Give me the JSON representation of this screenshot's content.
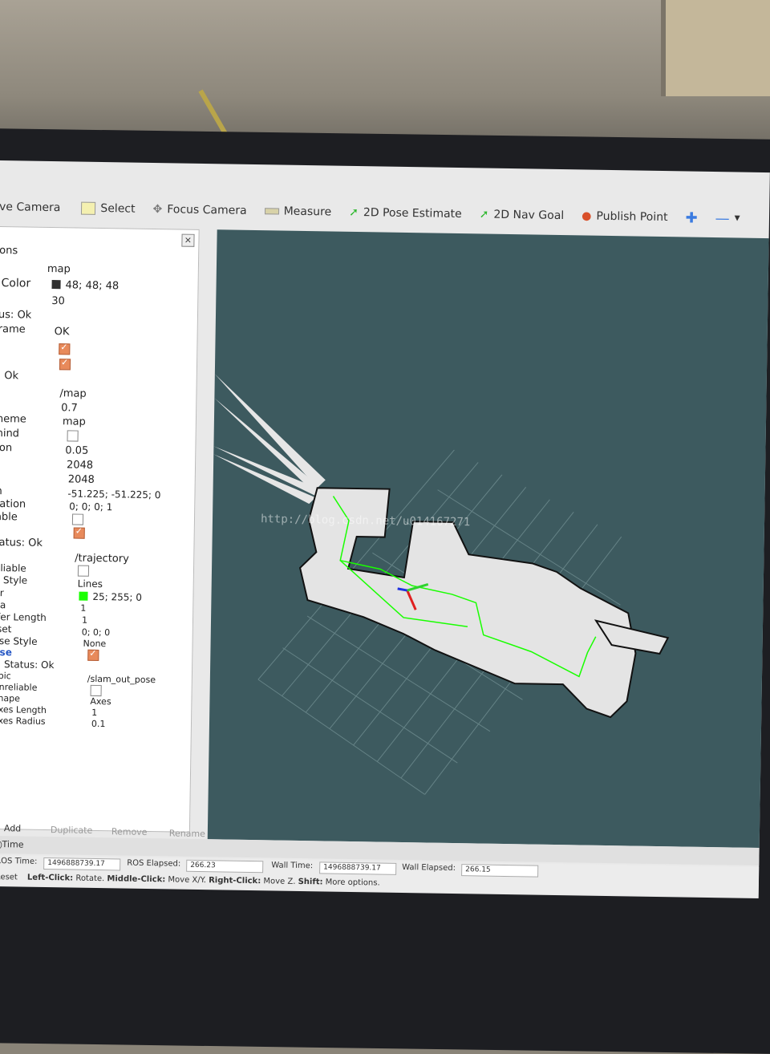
{
  "toolbar": {
    "move_camera": "ve Camera",
    "select": "Select",
    "focus_camera": "Focus Camera",
    "measure": "Measure",
    "pose_estimate": "2D Pose Estimate",
    "nav_goal": "2D Nav Goal",
    "publish_point": "Publish Point"
  },
  "panel": {
    "header": "ons",
    "close": "×",
    "rows": [
      {
        "label": "",
        "value": "map"
      },
      {
        "label": "Color",
        "value": "48; 48; 48"
      },
      {
        "label": "",
        "value": "30"
      },
      {
        "label": "us: Ok",
        "value": ""
      },
      {
        "label": "rame",
        "value": "OK"
      },
      {
        "label": ": Ok",
        "value": ""
      },
      {
        "label": "",
        "value": "/map"
      },
      {
        "label": "",
        "value": "0.7"
      },
      {
        "label": "neme",
        "value": "map"
      },
      {
        "label": "hind",
        "value": ""
      },
      {
        "label": "ion",
        "value": "0.05"
      },
      {
        "label": "",
        "value": "2048"
      },
      {
        "label": "",
        "value": "2048"
      },
      {
        "label": "n",
        "value": "-51.225; -51.225; 0"
      },
      {
        "label": "tation",
        "value": "0; 0; 0; 1"
      },
      {
        "label": "able",
        "value": ""
      },
      {
        "label": "tatus: Ok",
        "value": ""
      },
      {
        "label": "",
        "value": "/trajectory"
      },
      {
        "label": "eliable",
        "value": ""
      },
      {
        "label": "e Style",
        "value": "Lines"
      },
      {
        "label": "or",
        "value": "25; 255; 0"
      },
      {
        "label": "ha",
        "value": "1"
      },
      {
        "label": "ffer Length",
        "value": "1"
      },
      {
        "label": "fset",
        "value": "0; 0; 0"
      },
      {
        "label": "ose Style",
        "value": "None"
      },
      {
        "label": "ose",
        "value": ""
      },
      {
        "label": "Status: Ok",
        "value": ""
      },
      {
        "label": "opic",
        "value": "/slam_out_pose"
      },
      {
        "label": "Unreliable",
        "value": ""
      },
      {
        "label": "Shape",
        "value": "Axes"
      },
      {
        "label": "Axes Length",
        "value": "1"
      },
      {
        "label": "Axes Radius",
        "value": "0.1"
      }
    ],
    "buttons": {
      "add": "Add",
      "duplicate": "Duplicate",
      "remove": "Remove",
      "rename": "Rename"
    }
  },
  "time": {
    "title": "Time",
    "ros_time_label": "ROS Time:",
    "ros_time": "1496888739.17",
    "ros_elapsed_label": "ROS Elapsed:",
    "ros_elapsed": "266.23",
    "wall_time_label": "Wall Time:",
    "wall_time": "1496888739.17",
    "wall_elapsed_label": "Wall Elapsed:",
    "wall_elapsed": "266.15"
  },
  "status": {
    "reset": "Reset",
    "hint_left": "Left-Click:",
    "hint_left_text": "Rotate.",
    "hint_middle": "Middle-Click:",
    "hint_middle_text": "Move X/Y.",
    "hint_right": "Right-Click:",
    "hint_right_text": "Move Z.",
    "hint_shift": "Shift:",
    "hint_shift_text": "More options."
  },
  "watermark": "http://blog.csdn.net/u014167271",
  "colors": {
    "map_bg": "#3d5a5f",
    "trajectory": "#19ff00",
    "map_color_swatch": "#303030",
    "checked": "#e88a5b"
  }
}
